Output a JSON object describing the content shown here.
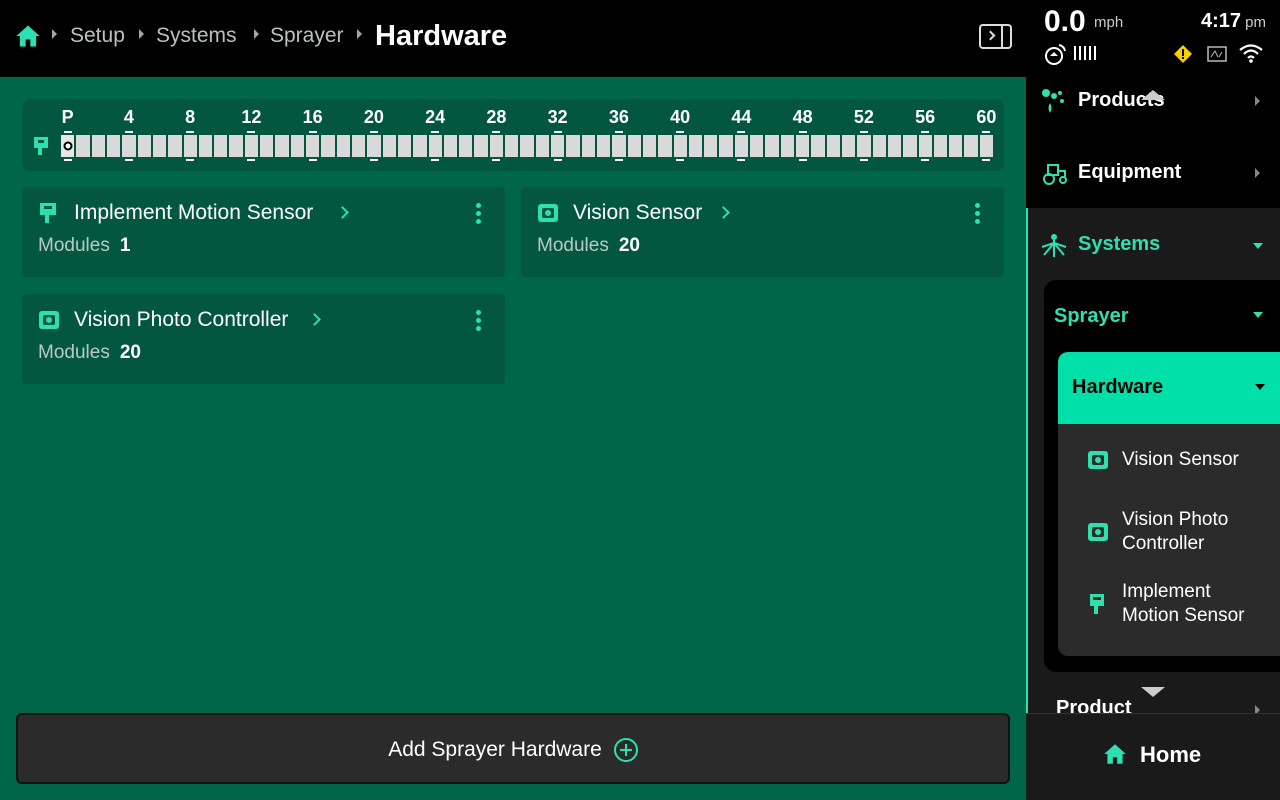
{
  "breadcrumb": {
    "items": [
      "Setup",
      "Systems",
      "Sprayer"
    ],
    "current": "Hardware"
  },
  "status": {
    "speed": "0.0",
    "speed_unit": "mph",
    "time": "4:17",
    "ampm": "pm"
  },
  "boom": {
    "labels": [
      "P",
      "4",
      "8",
      "12",
      "16",
      "20",
      "24",
      "28",
      "32",
      "36",
      "40",
      "44",
      "48",
      "52",
      "56",
      "60"
    ],
    "segments": 60
  },
  "cards": [
    {
      "title": "Implement Motion Sensor",
      "modules_label": "Modules",
      "modules_value": "1",
      "icon": "motion-sensor-icon"
    },
    {
      "title": "Vision Sensor",
      "modules_label": "Modules",
      "modules_value": "20",
      "icon": "vision-sensor-icon"
    },
    {
      "title": "Vision Photo Controller",
      "modules_label": "Modules",
      "modules_value": "20",
      "icon": "vision-controller-icon"
    }
  ],
  "add_button": "Add Sprayer Hardware",
  "sidebar": {
    "products": "Products",
    "equipment": "Equipment",
    "systems": "Systems",
    "sprayer": "Sprayer",
    "hardware": "Hardware",
    "sub_items": [
      "Vision Sensor",
      "Vision Photo Controller",
      "Implement Motion Sensor"
    ],
    "product": "Product",
    "home": "Home"
  },
  "colors": {
    "accent": "#2ee0b0",
    "main_bg": "#00664a",
    "card_bg": "#035640",
    "selected": "#00e0a8"
  }
}
